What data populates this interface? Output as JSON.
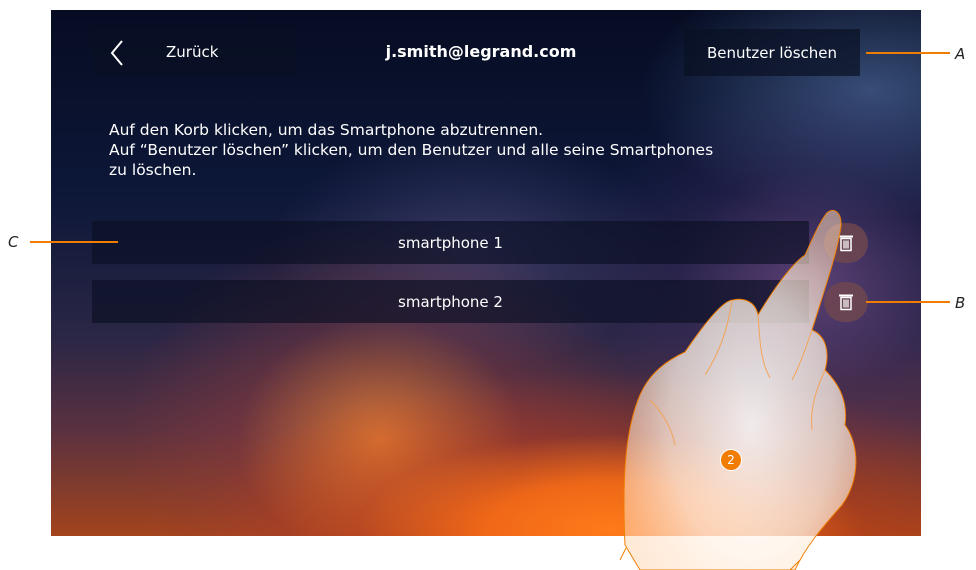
{
  "header": {
    "back_label": "Zurück",
    "title": "j.smith@legrand.com",
    "delete_user_label": "Benutzer löschen"
  },
  "instructions": {
    "line1": "Auf den Korb klicken, um das Smartphone abzutrennen.",
    "line2": "Auf “Benutzer löschen” klicken, um den Benutzer und alle seine Smartphones",
    "line3": "zu löschen."
  },
  "smartphones": [
    {
      "label": "smartphone 1",
      "action_icon": "trash-icon"
    },
    {
      "label": "smartphone 2",
      "action_icon": "trash-icon"
    }
  ],
  "callouts": {
    "a": "A",
    "b": "B",
    "c": "C"
  },
  "step_badge": "2",
  "colors": {
    "callout_line": "#f07d00",
    "step_badge": "#f07d00"
  }
}
